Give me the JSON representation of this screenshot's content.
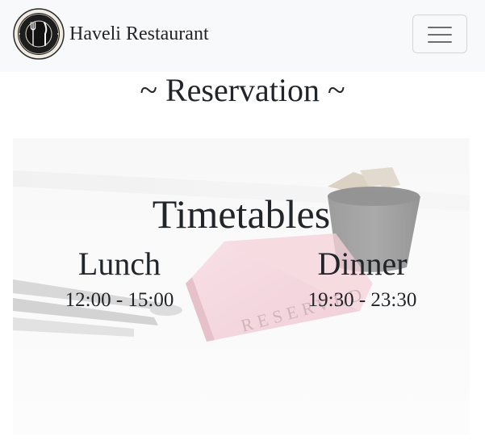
{
  "navbar": {
    "brand_name": "Haveli Restaurant",
    "logo_icon": "fork-knife-plate-icon",
    "toggler_icon": "hamburger-menu-icon"
  },
  "main": {
    "section_title": "~ Reservation ~",
    "hero": {
      "heading": "Timetables",
      "slots": [
        {
          "name": "Lunch",
          "time": "12:00 - 15:00"
        },
        {
          "name": "Dinner",
          "time": "19:30 - 23:30"
        }
      ],
      "sign_text": "RESERVED"
    }
  },
  "colors": {
    "navbar_bg": "#f8f9fa",
    "text": "#212529",
    "sign_pink": "#e8a4b4"
  }
}
